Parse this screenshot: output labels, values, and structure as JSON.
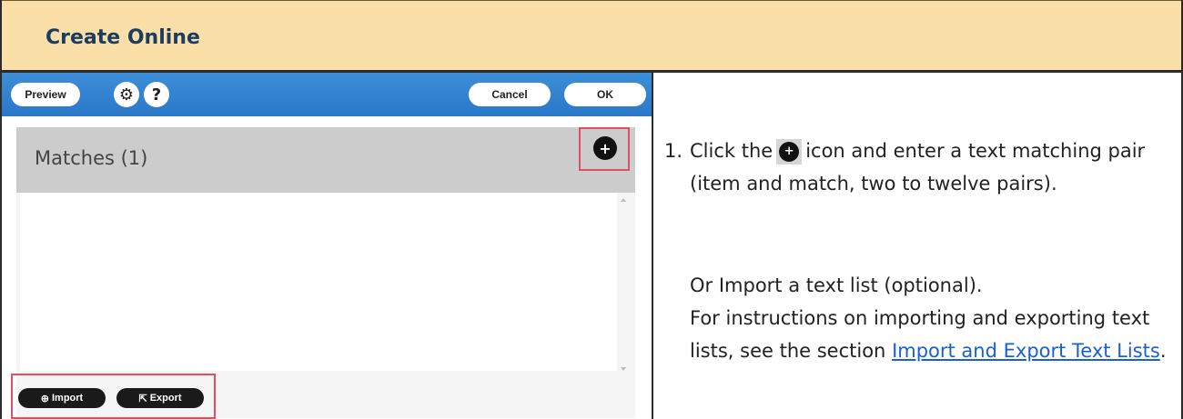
{
  "header": {
    "title": "Create Online"
  },
  "screenshot": {
    "toolbar": {
      "preview_label": "Preview",
      "settings_glyph": "⚙",
      "help_label": "?",
      "cancel_label": "Cancel",
      "ok_label": "OK"
    },
    "panel": {
      "title": "Matches (1)",
      "add_glyph": "+"
    },
    "bottom": {
      "import_label": "Import",
      "export_label": "Export"
    }
  },
  "instructions": {
    "step_number": "1.",
    "text_before_icon": "Click the",
    "icon_glyph": "+",
    "text_after_icon": "icon and enter a text matching pair (item and match, two to twelve pairs).",
    "import_line": "Or Import a text list (optional).",
    "see_section_text": "For instructions on importing and exporting text lists, see the section",
    "link_text": "Import and Export Text Lists",
    "period": "."
  },
  "colors": {
    "header_bg": "#fadfa8",
    "header_text": "#1c3d5f",
    "toolbar_blue": "#2a78c8",
    "highlight_red": "#e05060",
    "link_blue": "#1a5fd6"
  },
  "icons": [
    "settings-gear-icon",
    "help-icon",
    "add-circle-icon",
    "import-icon",
    "export-icon"
  ]
}
